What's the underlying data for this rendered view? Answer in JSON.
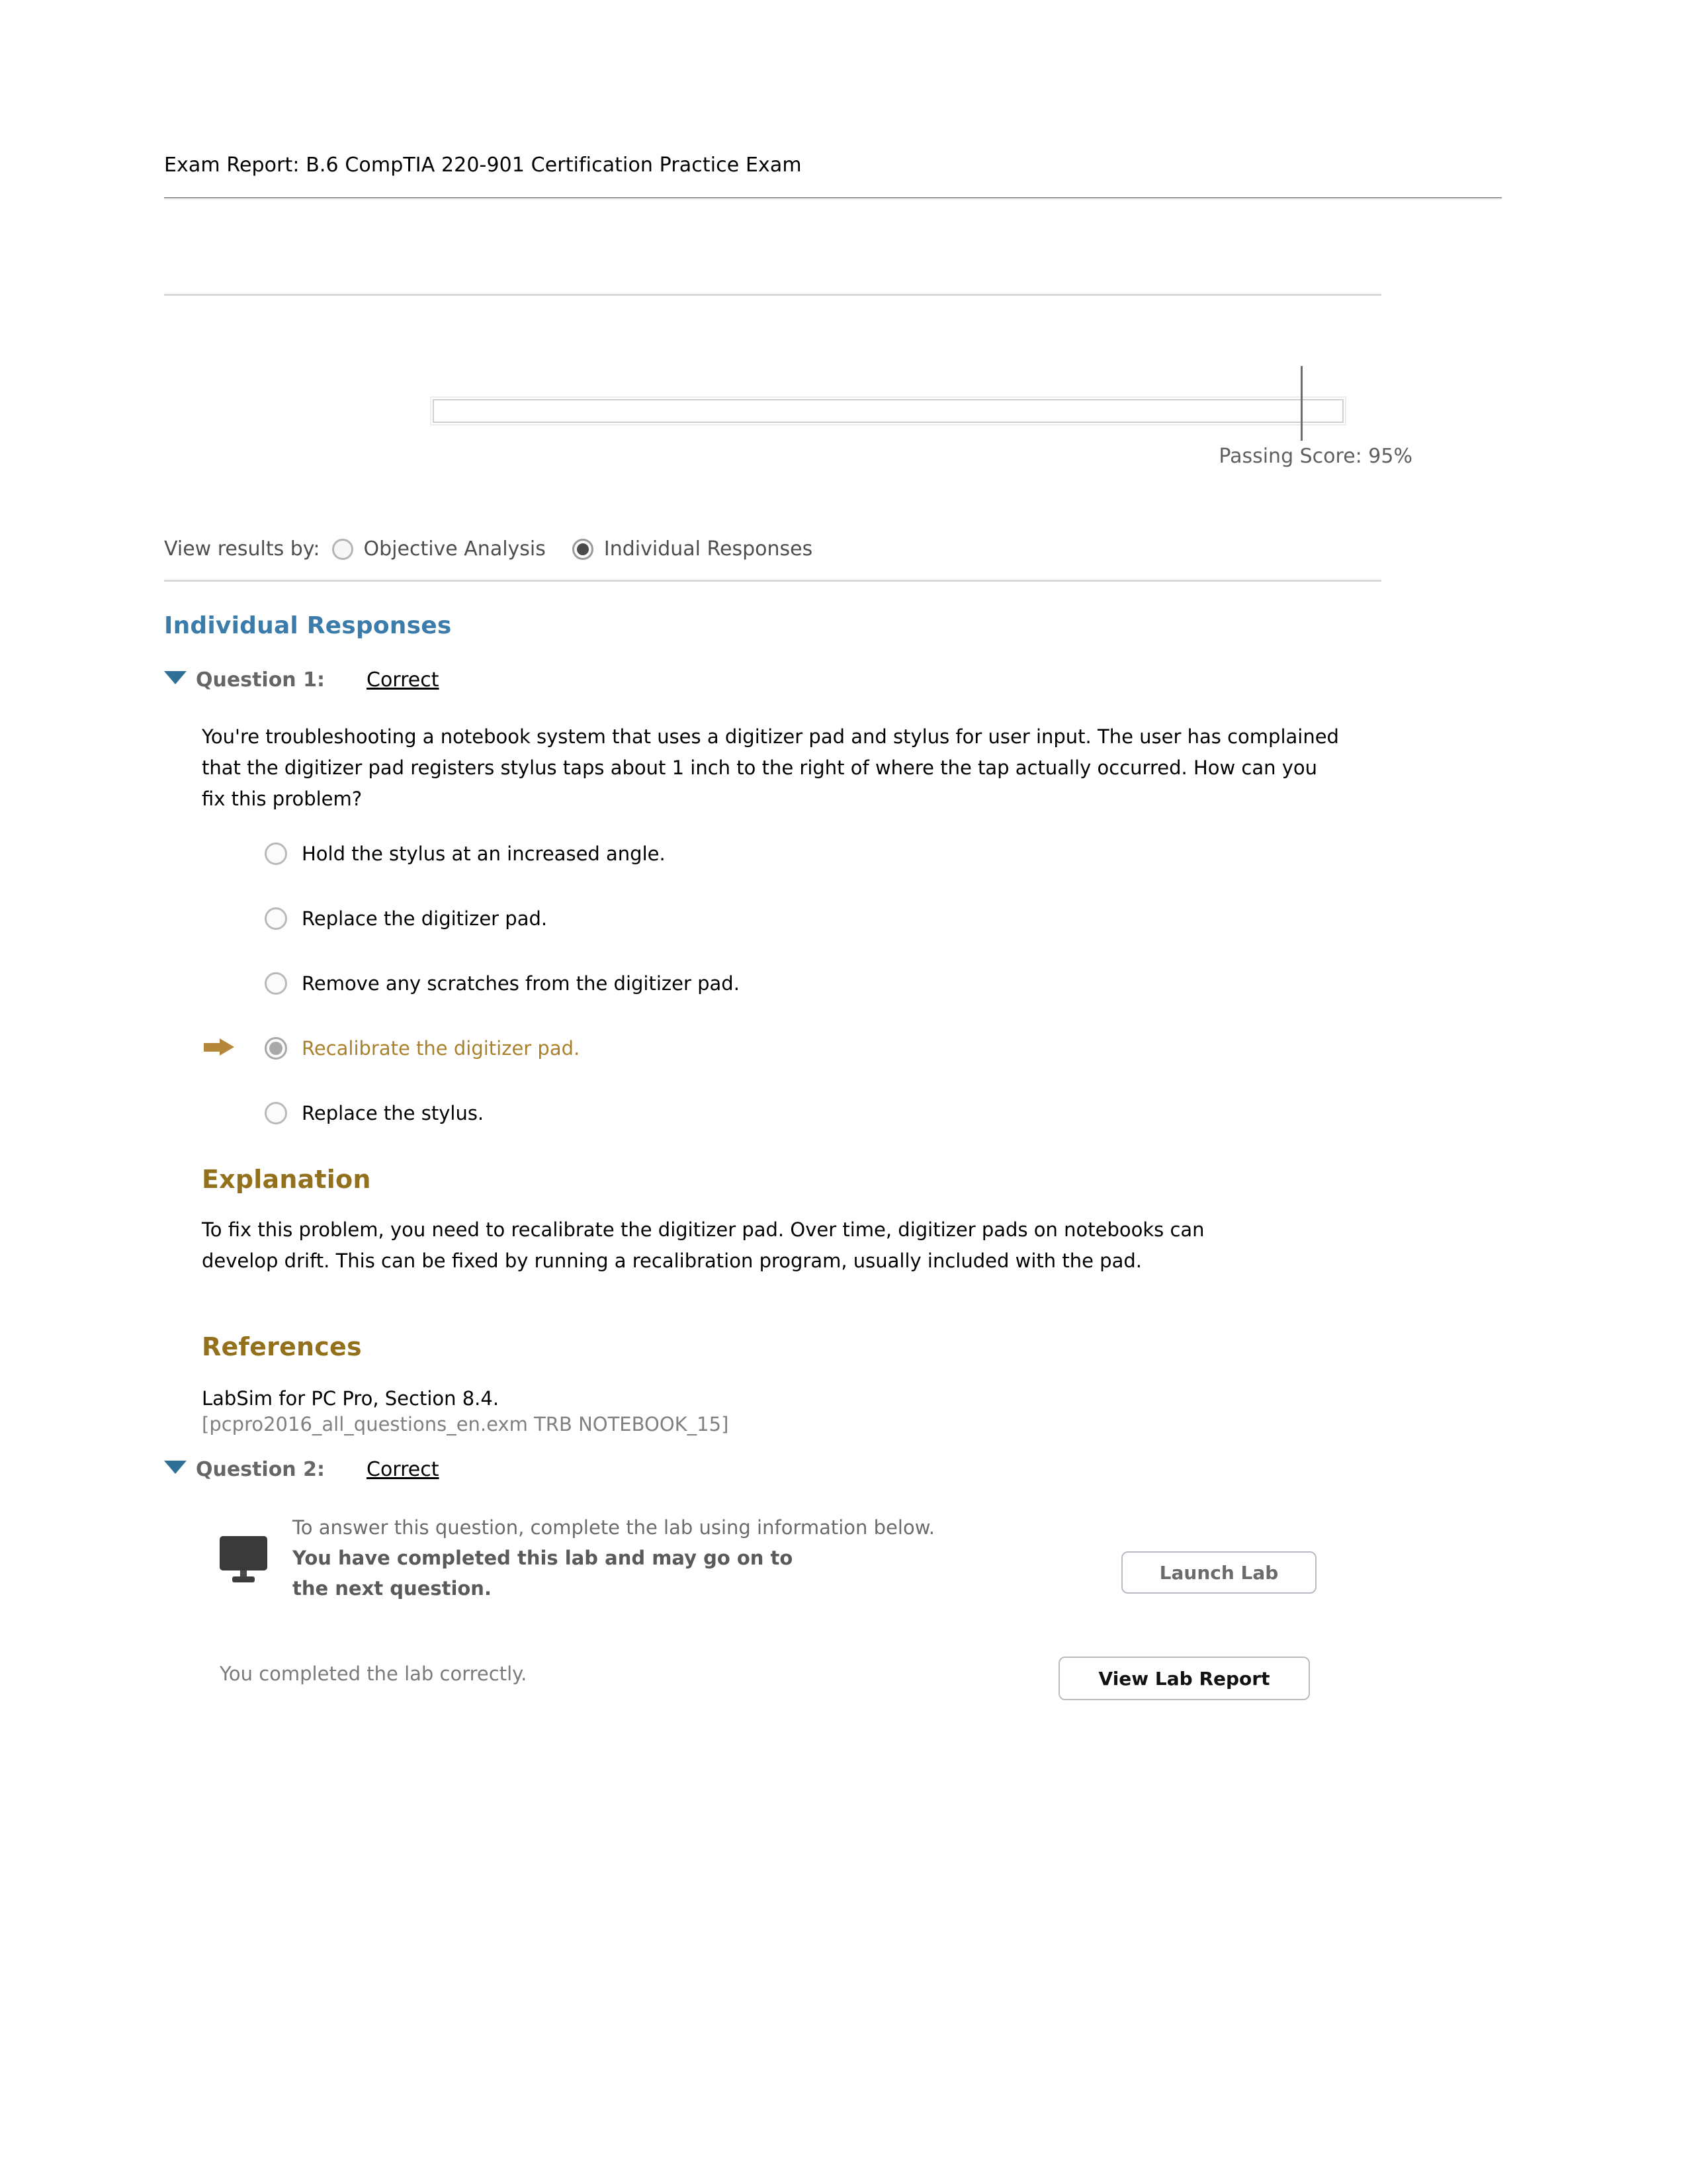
{
  "report": {
    "title": "Exam Report: B.6 CompTIA 220-901 Certification Practice Exam"
  },
  "score_bar": {
    "passing_score_label": "Passing Score: 95%",
    "passing_score_percent": 95
  },
  "view_results": {
    "label": "View results by:",
    "options": [
      {
        "label": "Objective Analysis",
        "selected": false
      },
      {
        "label": "Individual Responses",
        "selected": true
      }
    ]
  },
  "individual_responses": {
    "heading": "Individual Responses",
    "questions": [
      {
        "label": "Question 1:",
        "status": "Correct",
        "prompt": "You're troubleshooting a notebook system that uses a digitizer pad and stylus for user input. The user has complained that the digitizer pad registers stylus taps about 1 inch to the right of where the tap actually occurred. How can you fix this problem?",
        "options": [
          {
            "text": "Hold the stylus at an increased angle.",
            "selected": false
          },
          {
            "text": "Replace the digitizer pad.",
            "selected": false
          },
          {
            "text": "Remove any scratches from the digitizer pad.",
            "selected": false
          },
          {
            "text": "Recalibrate the digitizer pad.",
            "selected": true
          },
          {
            "text": "Replace the stylus.",
            "selected": false
          }
        ],
        "explanation_heading": "Explanation",
        "explanation": "To fix this problem, you need to recalibrate the digitizer pad. Over time, digitizer pads on notebooks can develop drift. This can be fixed by running a recalibration program, usually included with the pad.",
        "references_heading": "References",
        "reference": "LabSim for PC Pro, Section 8.4.",
        "reference_id": "[pcpro2016_all_questions_en.exm TRB NOTEBOOK_15]"
      },
      {
        "label": "Question 2:",
        "status": "Correct",
        "lab_instruction": "To answer this question, complete the lab using information below.",
        "lab_completed_message": "You have completed this lab and may go on to the next question.",
        "lab_status": "You completed the lab correctly.",
        "launch_lab_button": "Launch Lab",
        "view_lab_report_button": "View Lab Report"
      }
    ]
  },
  "colors": {
    "section_heading_blue": "#3b7cab",
    "gold_heading": "#93701c",
    "selected_answer_gold": "#a9802c",
    "arrow_gold": "#b4873a",
    "caret_blue": "#2e7096"
  }
}
